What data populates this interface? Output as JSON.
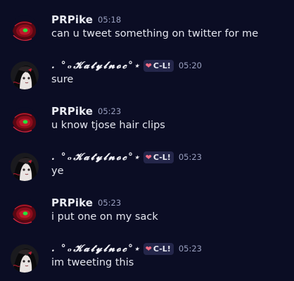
{
  "messages": [
    {
      "author": "PRPike",
      "time": "05:18",
      "text": "can u tweet something on twitter for me",
      "fancy": false
    },
    {
      "author": "  .  °ₒ𝓚𝓪𝓽𝔂𝓵𝓷𝓸𝓬°⋆",
      "time": "05:20",
      "text": "sure",
      "fancy": true,
      "badge": {
        "icon": "heart-icon",
        "label": "C-L!"
      }
    },
    {
      "author": "PRPike",
      "time": "05:23",
      "text": "u know tjose hair clips",
      "fancy": false
    },
    {
      "author": "  .  °ₒ𝓚𝓪𝓽𝔂𝓵𝓷𝓸𝓬°⋆",
      "time": "05:23",
      "text": "ye",
      "fancy": true,
      "badge": {
        "icon": "heart-icon",
        "label": "C-L!"
      }
    },
    {
      "author": "PRPike",
      "time": "05:23",
      "text": "i put one on my sack",
      "fancy": false
    },
    {
      "author": "  .  °ₒ𝓚𝓪𝓽𝔂𝓵𝓷𝓸𝓬°⋆",
      "time": "05:23",
      "text": "im tweeting this",
      "fancy": true,
      "badge": {
        "icon": "heart-icon",
        "label": "C-L!"
      }
    }
  ],
  "colors": {
    "background": "#0b0d24",
    "badge_bg": "#24264a",
    "heart": "#f26d86",
    "timestamp": "#9aa0c0"
  }
}
